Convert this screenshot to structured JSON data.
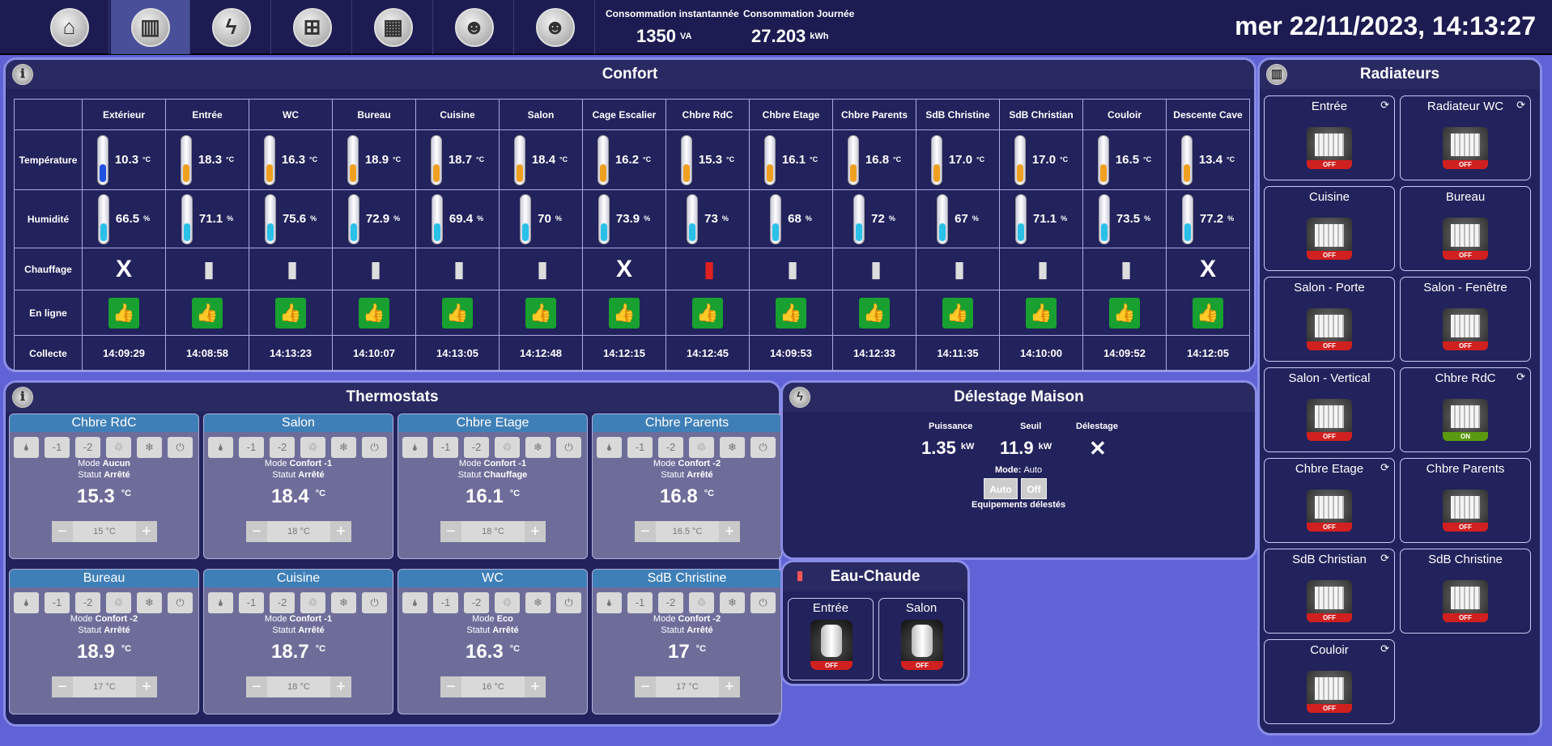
{
  "nav": [
    {
      "icon": "home-icon",
      "glyph": "⌂"
    },
    {
      "icon": "radiator-icon",
      "glyph": "▥"
    },
    {
      "icon": "lightning-icon",
      "glyph": "ϟ"
    },
    {
      "icon": "network-icon",
      "glyph": "⊞"
    },
    {
      "icon": "calendar-icon",
      "glyph": "▦"
    },
    {
      "icon": "masks-icon",
      "glyph": "☻"
    },
    {
      "icon": "masks-icon",
      "glyph": "☻"
    }
  ],
  "conso": {
    "inst_label": "Consommation instantannée",
    "inst_value": "1350",
    "inst_unit": "VA",
    "day_label": "Consommation Journée",
    "day_value": "27.203",
    "day_unit": "kWh"
  },
  "clock": "mer 22/11/2023, 14:13:27",
  "confort": {
    "title": "Confort",
    "row_labels": {
      "temp": "Température",
      "hum": "Humidité",
      "chauf": "Chauffage",
      "online": "En ligne",
      "collect": "Collecte"
    },
    "rooms": [
      {
        "name": "Extérieur",
        "temp": "10.3",
        "hum": "66.5",
        "heating": "none",
        "collect": "14:09:29"
      },
      {
        "name": "Entrée",
        "temp": "18.3",
        "hum": "71.1",
        "heating": "off",
        "collect": "14:08:58"
      },
      {
        "name": "WC",
        "temp": "16.3",
        "hum": "75.6",
        "heating": "off",
        "collect": "14:13:23"
      },
      {
        "name": "Bureau",
        "temp": "18.9",
        "hum": "72.9",
        "heating": "off",
        "collect": "14:10:07"
      },
      {
        "name": "Cuisine",
        "temp": "18.7",
        "hum": "69.4",
        "heating": "off",
        "collect": "14:13:05"
      },
      {
        "name": "Salon",
        "temp": "18.4",
        "hum": "70",
        "heating": "off",
        "collect": "14:12:48"
      },
      {
        "name": "Cage Escalier",
        "temp": "16.2",
        "hum": "73.9",
        "heating": "none",
        "collect": "14:12:15"
      },
      {
        "name": "Chbre RdC",
        "temp": "15.3",
        "hum": "73",
        "heating": "on",
        "collect": "14:12:45"
      },
      {
        "name": "Chbre Etage",
        "temp": "16.1",
        "hum": "68",
        "heating": "off",
        "collect": "14:09:53"
      },
      {
        "name": "Chbre Parents",
        "temp": "16.8",
        "hum": "72",
        "heating": "off",
        "collect": "14:12:33"
      },
      {
        "name": "SdB Christine",
        "temp": "17.0",
        "hum": "67",
        "heating": "off",
        "collect": "14:11:35"
      },
      {
        "name": "SdB Christian",
        "temp": "17.0",
        "hum": "71.1",
        "heating": "off",
        "collect": "14:10:00"
      },
      {
        "name": "Couloir",
        "temp": "16.5",
        "hum": "73.5",
        "heating": "off",
        "collect": "14:09:52"
      },
      {
        "name": "Descente Cave",
        "temp": "13.4",
        "hum": "77.2",
        "heating": "none",
        "collect": "14:12:05"
      }
    ],
    "temp_unit": "°C",
    "hum_unit": "%"
  },
  "thermostats": {
    "title": "Thermostats",
    "mode_word": "Mode",
    "statut_word": "Statut",
    "unit": "°C",
    "cards": [
      {
        "name": "Chbre RdC",
        "mode": "Aucun",
        "statut": "Arrêté",
        "temp": "15.3",
        "set": "15 °C"
      },
      {
        "name": "Salon",
        "mode": "Confort -1",
        "statut": "Arrêté",
        "temp": "18.4",
        "set": "18 °C"
      },
      {
        "name": "Chbre Etage",
        "mode": "Confort -1",
        "statut": "Chauffage",
        "temp": "16.1",
        "set": "18 °C"
      },
      {
        "name": "Chbre Parents",
        "mode": "Confort -2",
        "statut": "Arrêté",
        "temp": "16.8",
        "set": "16.5 °C"
      },
      {
        "name": "Bureau",
        "mode": "Confort -2",
        "statut": "Arrêté",
        "temp": "18.9",
        "set": "17 °C"
      },
      {
        "name": "Cuisine",
        "mode": "Confort -1",
        "statut": "Arrêté",
        "temp": "18.7",
        "set": "18 °C"
      },
      {
        "name": "WC",
        "mode": "Eco",
        "statut": "Arrêté",
        "temp": "16.3",
        "set": "16 °C"
      },
      {
        "name": "SdB Christine",
        "mode": "Confort -2",
        "statut": "Arrêté",
        "temp": "17",
        "set": "17 °C"
      }
    ]
  },
  "delestage": {
    "title": "Délestage Maison",
    "p_label": "Puissance",
    "p_value": "1.35",
    "p_unit": "kW",
    "s_label": "Seuil",
    "s_value": "11.9",
    "s_unit": "kW",
    "d_label": "Délestage",
    "mode_label": "Mode:",
    "mode_value": "Auto",
    "btn_auto": "Auto",
    "btn_off": "Off",
    "equip": "Equipements délestés"
  },
  "eau": {
    "title": "Eau-Chaude",
    "items": [
      {
        "name": "Entrée",
        "state": "OFF"
      },
      {
        "name": "Salon",
        "state": "OFF"
      }
    ]
  },
  "radiateurs": {
    "title": "Radiateurs",
    "items": [
      {
        "name": "Entrée",
        "state": "OFF"
      },
      {
        "name": "Radiateur WC",
        "state": "OFF"
      },
      {
        "name": "Cuisine",
        "state": "OFF"
      },
      {
        "name": "Bureau",
        "state": "OFF"
      },
      {
        "name": "Salon - Porte",
        "state": "OFF"
      },
      {
        "name": "Salon - Fenêtre",
        "state": "OFF"
      },
      {
        "name": "Salon - Vertical",
        "state": "OFF"
      },
      {
        "name": "Chbre RdC",
        "state": "ON"
      },
      {
        "name": "Chbre Etage",
        "state": "OFF"
      },
      {
        "name": "Chbre Parents",
        "state": "OFF"
      },
      {
        "name": "SdB Christian",
        "state": "OFF"
      },
      {
        "name": "SdB Christine",
        "state": "OFF"
      },
      {
        "name": "Couloir",
        "state": "OFF"
      }
    ]
  },
  "thermostat_buttons": [
    "🌢",
    "-1",
    "-2",
    "♲",
    "❄",
    "⏻"
  ],
  "thermostat_button_icons": [
    "fire-icon",
    "minus1-icon",
    "minus2-icon",
    "eco-icon",
    "snowflake-icon",
    "power-icon"
  ]
}
